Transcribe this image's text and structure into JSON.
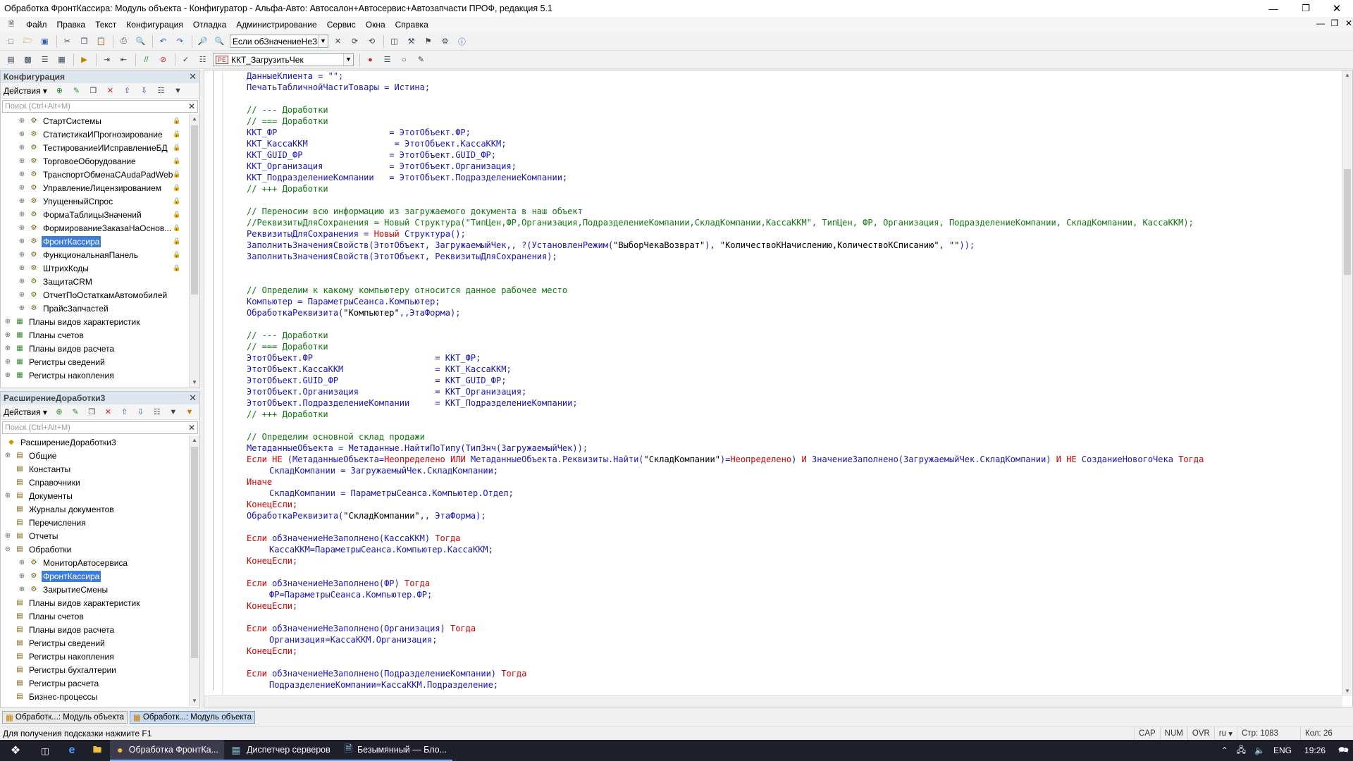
{
  "window": {
    "title": "Обработка ФронтКассира: Модуль объекта - Конфигуратор - Альфа-Авто: Автосалон+Автосервис+Автозапчасти ПРОФ, редакция 5.1"
  },
  "menu": [
    "Файл",
    "Правка",
    "Текст",
    "Конфигурация",
    "Отладка",
    "Администрирование",
    "Сервис",
    "Окна",
    "Справка"
  ],
  "toolbar": {
    "search_value": "Если обЗначениеНеЗа",
    "proc_value": "ККТ_ЗагрузитьЧек",
    "proc_badge": "РЕ"
  },
  "config_panel": {
    "title": "Конфигурация",
    "actions_label": "Действия",
    "search_placeholder": "Поиск (Ctrl+Alt+M)",
    "items": [
      {
        "label": "СтартСистемы",
        "lock": true
      },
      {
        "label": "СтатистикаИПрогнозирование",
        "lock": true
      },
      {
        "label": "ТестированиеИИсправлениеБД",
        "lock": true
      },
      {
        "label": "ТорговоеОборудование",
        "lock": true
      },
      {
        "label": "ТранспортОбменаСAudaPadWeb",
        "lock": true
      },
      {
        "label": "УправлениеЛицензированием",
        "lock": true
      },
      {
        "label": "УпущенныйСпрос",
        "lock": true
      },
      {
        "label": "ФормаТаблицыЗначений",
        "lock": true
      },
      {
        "label": "ФормированиеЗаказаНаОснов...",
        "lock": true
      },
      {
        "label": "ФронтКассира",
        "lock": true,
        "selected": true
      },
      {
        "label": "ФункциональнаяПанель",
        "lock": true
      },
      {
        "label": "ШтрихКоды",
        "lock": true
      },
      {
        "label": "ЗащитаCRM",
        "lock": false
      },
      {
        "label": "ОтчетПоОстаткамАвтомобилей",
        "lock": false
      },
      {
        "label": "ПрайсЗапчастей",
        "lock": false
      }
    ],
    "groups": [
      "Планы видов характеристик",
      "Планы счетов",
      "Планы видов расчета",
      "Регистры сведений",
      "Регистры накопления"
    ]
  },
  "ext_panel": {
    "title": "РасширениеДоработки3",
    "actions_label": "Действия",
    "search_placeholder": "Поиск (Ctrl+Alt+M)",
    "root": "РасширениеДоработки3",
    "items": [
      {
        "label": "Общие",
        "level": 1,
        "exp": "⊕"
      },
      {
        "label": "Константы",
        "level": 1,
        "exp": ""
      },
      {
        "label": "Справочники",
        "level": 1,
        "exp": ""
      },
      {
        "label": "Документы",
        "level": 1,
        "exp": "⊕"
      },
      {
        "label": "Журналы документов",
        "level": 1,
        "exp": ""
      },
      {
        "label": "Перечисления",
        "level": 1,
        "exp": ""
      },
      {
        "label": "Отчеты",
        "level": 1,
        "exp": "⊕"
      },
      {
        "label": "Обработки",
        "level": 1,
        "exp": "⊖"
      },
      {
        "label": "МониторАвтосервиса",
        "level": 2,
        "exp": "⊕"
      },
      {
        "label": "ФронтКассира",
        "level": 2,
        "exp": "⊕",
        "selected": true
      },
      {
        "label": "ЗакрытиеСмены",
        "level": 2,
        "exp": "⊕"
      },
      {
        "label": "Планы видов характеристик",
        "level": 1,
        "exp": ""
      },
      {
        "label": "Планы счетов",
        "level": 1,
        "exp": ""
      },
      {
        "label": "Планы видов расчета",
        "level": 1,
        "exp": ""
      },
      {
        "label": "Регистры сведений",
        "level": 1,
        "exp": ""
      },
      {
        "label": "Регистры накопления",
        "level": 1,
        "exp": ""
      },
      {
        "label": "Регистры бухгалтерии",
        "level": 1,
        "exp": ""
      },
      {
        "label": "Регистры расчета",
        "level": 1,
        "exp": ""
      },
      {
        "label": "Бизнес-процессы",
        "level": 1,
        "exp": ""
      }
    ]
  },
  "code": [
    {
      "indent": 1,
      "tokens": [
        [
          "id",
          "ДанныеКлиента = \"\";"
        ]
      ]
    },
    {
      "indent": 1,
      "tokens": [
        [
          "id",
          "ПечатьТабличнойЧастиТовары = Истина;"
        ]
      ]
    },
    {
      "indent": 0,
      "tokens": []
    },
    {
      "indent": 1,
      "tokens": [
        [
          "cm",
          "// --- Доработки"
        ]
      ]
    },
    {
      "indent": 1,
      "tokens": [
        [
          "cm",
          "// === Доработки"
        ]
      ]
    },
    {
      "indent": 1,
      "tokens": [
        [
          "id",
          "ККТ_ФР                      = ЭтотОбъект.ФР;"
        ]
      ]
    },
    {
      "indent": 1,
      "tokens": [
        [
          "id",
          "ККТ_КассаККМ                 = ЭтотОбъект.КассаККМ;"
        ]
      ]
    },
    {
      "indent": 1,
      "tokens": [
        [
          "id",
          "ККТ_GUID_ФР                 = ЭтотОбъект.GUID_ФР;"
        ]
      ]
    },
    {
      "indent": 1,
      "tokens": [
        [
          "id",
          "ККТ_Организация             = ЭтотОбъект.Организация;"
        ]
      ]
    },
    {
      "indent": 1,
      "tokens": [
        [
          "id",
          "ККТ_ПодразделениеКомпании   = ЭтотОбъект.ПодразделениеКомпании;"
        ]
      ]
    },
    {
      "indent": 1,
      "tokens": [
        [
          "cm",
          "// +++ Доработки"
        ]
      ]
    },
    {
      "indent": 0,
      "tokens": []
    },
    {
      "indent": 1,
      "tokens": [
        [
          "cm",
          "// Переносим всю информацию из загружаемого документа в наш объект"
        ]
      ]
    },
    {
      "indent": 1,
      "tokens": [
        [
          "cm",
          "//РеквизитыДляСохранения = Новый Структура(\"ТипЦен,ФР,Организация,ПодразделениеКомпании,СкладКомпании,КассаККМ\", ТипЦен, ФР, Организация, ПодразделениеКомпании, СкладКомпании, КассаККМ);"
        ]
      ]
    },
    {
      "indent": 1,
      "tokens": [
        [
          "id",
          "РеквизитыДляСохранения = "
        ],
        [
          "kw",
          "Новый"
        ],
        [
          "id",
          " Структура();"
        ]
      ]
    },
    {
      "indent": 1,
      "tokens": [
        [
          "id",
          "ЗаполнитьЗначенияСвойств(ЭтотОбъект, ЗагружаемыйЧек,, ?(УстановленРежим("
        ],
        [
          "st",
          "\"ВыборЧекаВозврат\""
        ],
        [
          "id",
          "), "
        ],
        [
          "st",
          "\"КоличествоКНачислению,КоличествоКСписанию\""
        ],
        [
          "id",
          ", "
        ],
        [
          "st",
          "\"\""
        ],
        [
          "id",
          "));"
        ]
      ]
    },
    {
      "indent": 1,
      "tokens": [
        [
          "id",
          "ЗаполнитьЗначенияСвойств(ЭтотОбъект, РеквизитыДляСохранения);"
        ]
      ]
    },
    {
      "indent": 0,
      "tokens": []
    },
    {
      "indent": 0,
      "tokens": []
    },
    {
      "indent": 1,
      "tokens": [
        [
          "cm",
          "// Определим к какому компьютеру относится данное рабочее место"
        ]
      ]
    },
    {
      "indent": 1,
      "tokens": [
        [
          "id",
          "Компьютер = ПараметрыСеанса.Компьютер;"
        ]
      ]
    },
    {
      "indent": 1,
      "tokens": [
        [
          "id",
          "ОбработкаРеквизита("
        ],
        [
          "st",
          "\"Компьютер\""
        ],
        [
          "id",
          ",,ЭтаФорма);"
        ]
      ]
    },
    {
      "indent": 0,
      "tokens": []
    },
    {
      "indent": 1,
      "tokens": [
        [
          "cm",
          "// --- Доработки"
        ]
      ]
    },
    {
      "indent": 1,
      "tokens": [
        [
          "cm",
          "// === Доработки"
        ]
      ]
    },
    {
      "indent": 1,
      "tokens": [
        [
          "id",
          "ЭтотОбъект.ФР                        = ККТ_ФР;"
        ]
      ]
    },
    {
      "indent": 1,
      "tokens": [
        [
          "id",
          "ЭтотОбъект.КассаККМ                  = ККТ_КассаККМ;"
        ]
      ]
    },
    {
      "indent": 1,
      "tokens": [
        [
          "id",
          "ЭтотОбъект.GUID_ФР                   = ККТ_GUID_ФР;"
        ]
      ]
    },
    {
      "indent": 1,
      "tokens": [
        [
          "id",
          "ЭтотОбъект.Организация               = ККТ_Организация;"
        ]
      ]
    },
    {
      "indent": 1,
      "tokens": [
        [
          "id",
          "ЭтотОбъект.ПодразделениеКомпании     = ККТ_ПодразделениеКомпании;"
        ]
      ]
    },
    {
      "indent": 1,
      "tokens": [
        [
          "cm",
          "// +++ Доработки"
        ]
      ]
    },
    {
      "indent": 0,
      "tokens": []
    },
    {
      "indent": 1,
      "tokens": [
        [
          "cm",
          "// Определим основной склад продажи"
        ]
      ]
    },
    {
      "indent": 1,
      "tokens": [
        [
          "id",
          "МетаданныеОбъекта = Метаданные.НайтиПоТипу(ТипЗнч(ЗагружаемыйЧек));"
        ]
      ]
    },
    {
      "indent": 1,
      "tokens": [
        [
          "kw",
          "Если НЕ"
        ],
        [
          "id",
          " (МетаданныеОбъекта="
        ],
        [
          "kw",
          "Неопределено ИЛИ"
        ],
        [
          "id",
          " МетаданныеОбъекта.Реквизиты.Найти("
        ],
        [
          "st",
          "\"СкладКомпании\""
        ],
        [
          "id",
          ")="
        ],
        [
          "kw",
          "Неопределено"
        ],
        [
          "id",
          ") "
        ],
        [
          "kw",
          "И"
        ],
        [
          "id",
          " ЗначениеЗаполнено(ЗагружаемыйЧек.СкладКомпании) "
        ],
        [
          "kw",
          "И НЕ"
        ],
        [
          "id",
          " СозданиеНовогоЧека "
        ],
        [
          "kw",
          "Тогда"
        ]
      ]
    },
    {
      "indent": 2,
      "tokens": [
        [
          "id",
          "СкладКомпании = ЗагружаемыйЧек.СкладКомпании;"
        ]
      ]
    },
    {
      "indent": 1,
      "tokens": [
        [
          "kw",
          "Иначе"
        ]
      ]
    },
    {
      "indent": 2,
      "tokens": [
        [
          "id",
          "СкладКомпании = ПараметрыСеанса.Компьютер.Отдел;"
        ]
      ]
    },
    {
      "indent": 1,
      "tokens": [
        [
          "kw",
          "КонецЕсли;"
        ]
      ]
    },
    {
      "indent": 1,
      "tokens": [
        [
          "id",
          "ОбработкаРеквизита("
        ],
        [
          "st",
          "\"СкладКомпании\""
        ],
        [
          "id",
          ",, ЭтаФорма);"
        ]
      ]
    },
    {
      "indent": 0,
      "tokens": []
    },
    {
      "indent": 1,
      "tokens": [
        [
          "kw",
          "Если"
        ],
        [
          "id",
          " обЗначениеНеЗаполнено(КассаККМ) "
        ],
        [
          "kw",
          "Тогда"
        ]
      ]
    },
    {
      "indent": 2,
      "tokens": [
        [
          "id",
          "КассаККМ=ПараметрыСеанса.Компьютер.КассаККМ;"
        ]
      ]
    },
    {
      "indent": 1,
      "tokens": [
        [
          "kw",
          "КонецЕсли;"
        ]
      ]
    },
    {
      "indent": 0,
      "tokens": []
    },
    {
      "indent": 1,
      "tokens": [
        [
          "kw",
          "Если"
        ],
        [
          "id",
          " обЗначениеНеЗаполнено(ФР) "
        ],
        [
          "kw",
          "Тогда"
        ]
      ]
    },
    {
      "indent": 2,
      "tokens": [
        [
          "id",
          "ФР=ПараметрыСеанса.Компьютер.ФР;"
        ]
      ]
    },
    {
      "indent": 1,
      "tokens": [
        [
          "kw",
          "КонецЕсли;"
        ]
      ]
    },
    {
      "indent": 0,
      "tokens": []
    },
    {
      "indent": 1,
      "tokens": [
        [
          "kw",
          "Если"
        ],
        [
          "id",
          " обЗначениеНеЗаполнено(Организация) "
        ],
        [
          "kw",
          "Тогда"
        ]
      ]
    },
    {
      "indent": 2,
      "tokens": [
        [
          "id",
          "Организация=КассаККМ.Организация;"
        ]
      ]
    },
    {
      "indent": 1,
      "tokens": [
        [
          "kw",
          "КонецЕсли;"
        ]
      ]
    },
    {
      "indent": 0,
      "tokens": []
    },
    {
      "indent": 1,
      "tokens": [
        [
          "kw",
          "Если"
        ],
        [
          "id",
          " обЗначениеНеЗаполнено(ПодразделениеКомпании) "
        ],
        [
          "kw",
          "Тогда"
        ]
      ]
    },
    {
      "indent": 2,
      "tokens": [
        [
          "id",
          "ПодразделениеКомпании=КассаККМ.Подразделение;"
        ]
      ]
    }
  ],
  "tabs": [
    "Обработк...: Модуль объекта",
    "Обработк...: Модуль объекта"
  ],
  "status": {
    "hint": "Для получения подсказки нажмите F1",
    "cap": "CAP",
    "num": "NUM",
    "ovr": "OVR",
    "lang": "ru",
    "line": "Стр: 1083",
    "col": "Кол: 26"
  },
  "taskbar": {
    "apps": [
      "Обработка ФронтКа...",
      "Диспетчер серверов",
      "Безымянный — Бло..."
    ],
    "lang": "ENG",
    "time": "19:26"
  }
}
